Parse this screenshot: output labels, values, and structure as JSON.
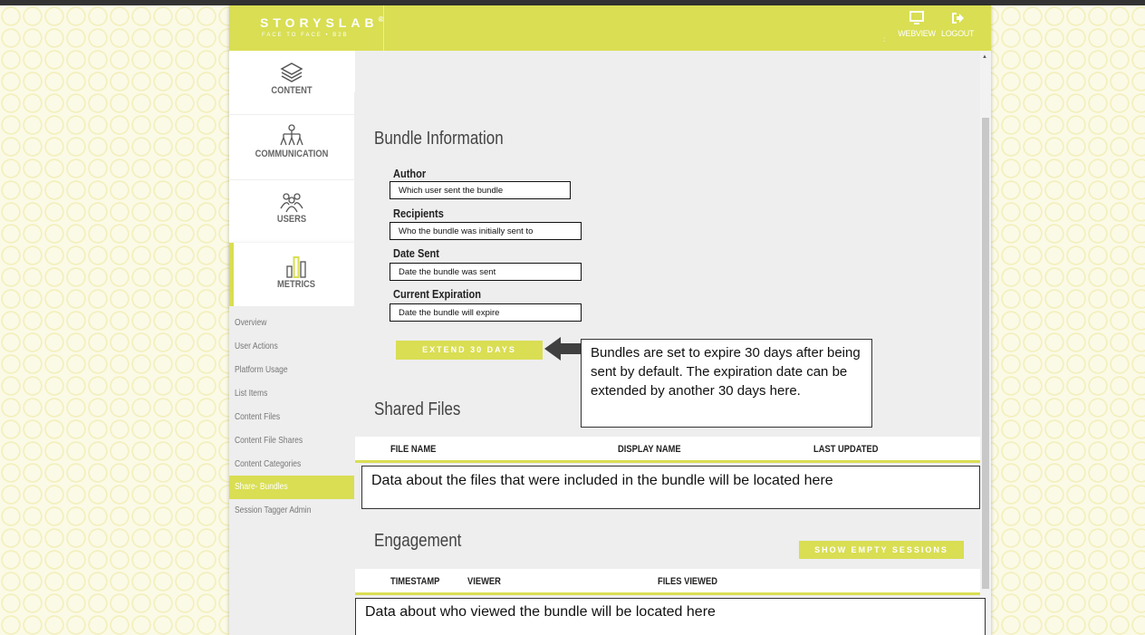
{
  "app": {
    "logo": "STORYSLAB",
    "logo_mark": "®",
    "tagline": "FACE TO FACE • B2B",
    "header_buttons": [
      {
        "label": "WEBVIEW",
        "icon": "monitor-icon"
      },
      {
        "label": "LOGOUT",
        "icon": "logout-icon"
      }
    ],
    "header_separator": ":"
  },
  "sidebar": {
    "items": [
      {
        "label": "CONTENT",
        "icon": "layers-icon"
      },
      {
        "label": "COMMUNICATION",
        "icon": "org-chart-icon"
      },
      {
        "label": "USERS",
        "icon": "users-icon"
      },
      {
        "label": "METRICS",
        "icon": "bar-chart-icon",
        "active": true
      }
    ],
    "subitems": [
      {
        "label": "Overview"
      },
      {
        "label": "User Actions"
      },
      {
        "label": "Platform Usage"
      },
      {
        "label": "List Items"
      },
      {
        "label": "Content Files"
      },
      {
        "label": "Content File Shares"
      },
      {
        "label": "Content Categories"
      },
      {
        "label": "Share- Bundles",
        "active": true
      },
      {
        "label": "Session Tagger Admin"
      }
    ]
  },
  "bundle": {
    "title": "Bundle Information",
    "fields": [
      {
        "label": "Author",
        "value": "Which user sent the bundle"
      },
      {
        "label": "Recipients",
        "value": "Who the bundle was initially sent to"
      },
      {
        "label": "Date Sent",
        "value": "Date the bundle was sent"
      },
      {
        "label": "Current Expiration",
        "value": "Date the bundle will expire"
      }
    ],
    "extend_button": "EXTEND 30 DAYS",
    "callout": "Bundles are set to expire 30 days after being sent by default. The expiration date can be extended by another 30 days here."
  },
  "shared_files": {
    "title": "Shared Files",
    "columns": [
      "FILE NAME",
      "DISPLAY NAME",
      "LAST UPDATED"
    ],
    "note": "Data about the files that were included in the bundle will be located here"
  },
  "engagement": {
    "title": "Engagement",
    "show_empty_button": "SHOW EMPTY SESSIONS",
    "columns": [
      "TIMESTAMP",
      "VIEWER",
      "FILES VIEWED"
    ],
    "note": "Data about who viewed the bundle will be located here"
  },
  "colors": {
    "accent": "#d9de53",
    "panel": "#eeeeee"
  }
}
